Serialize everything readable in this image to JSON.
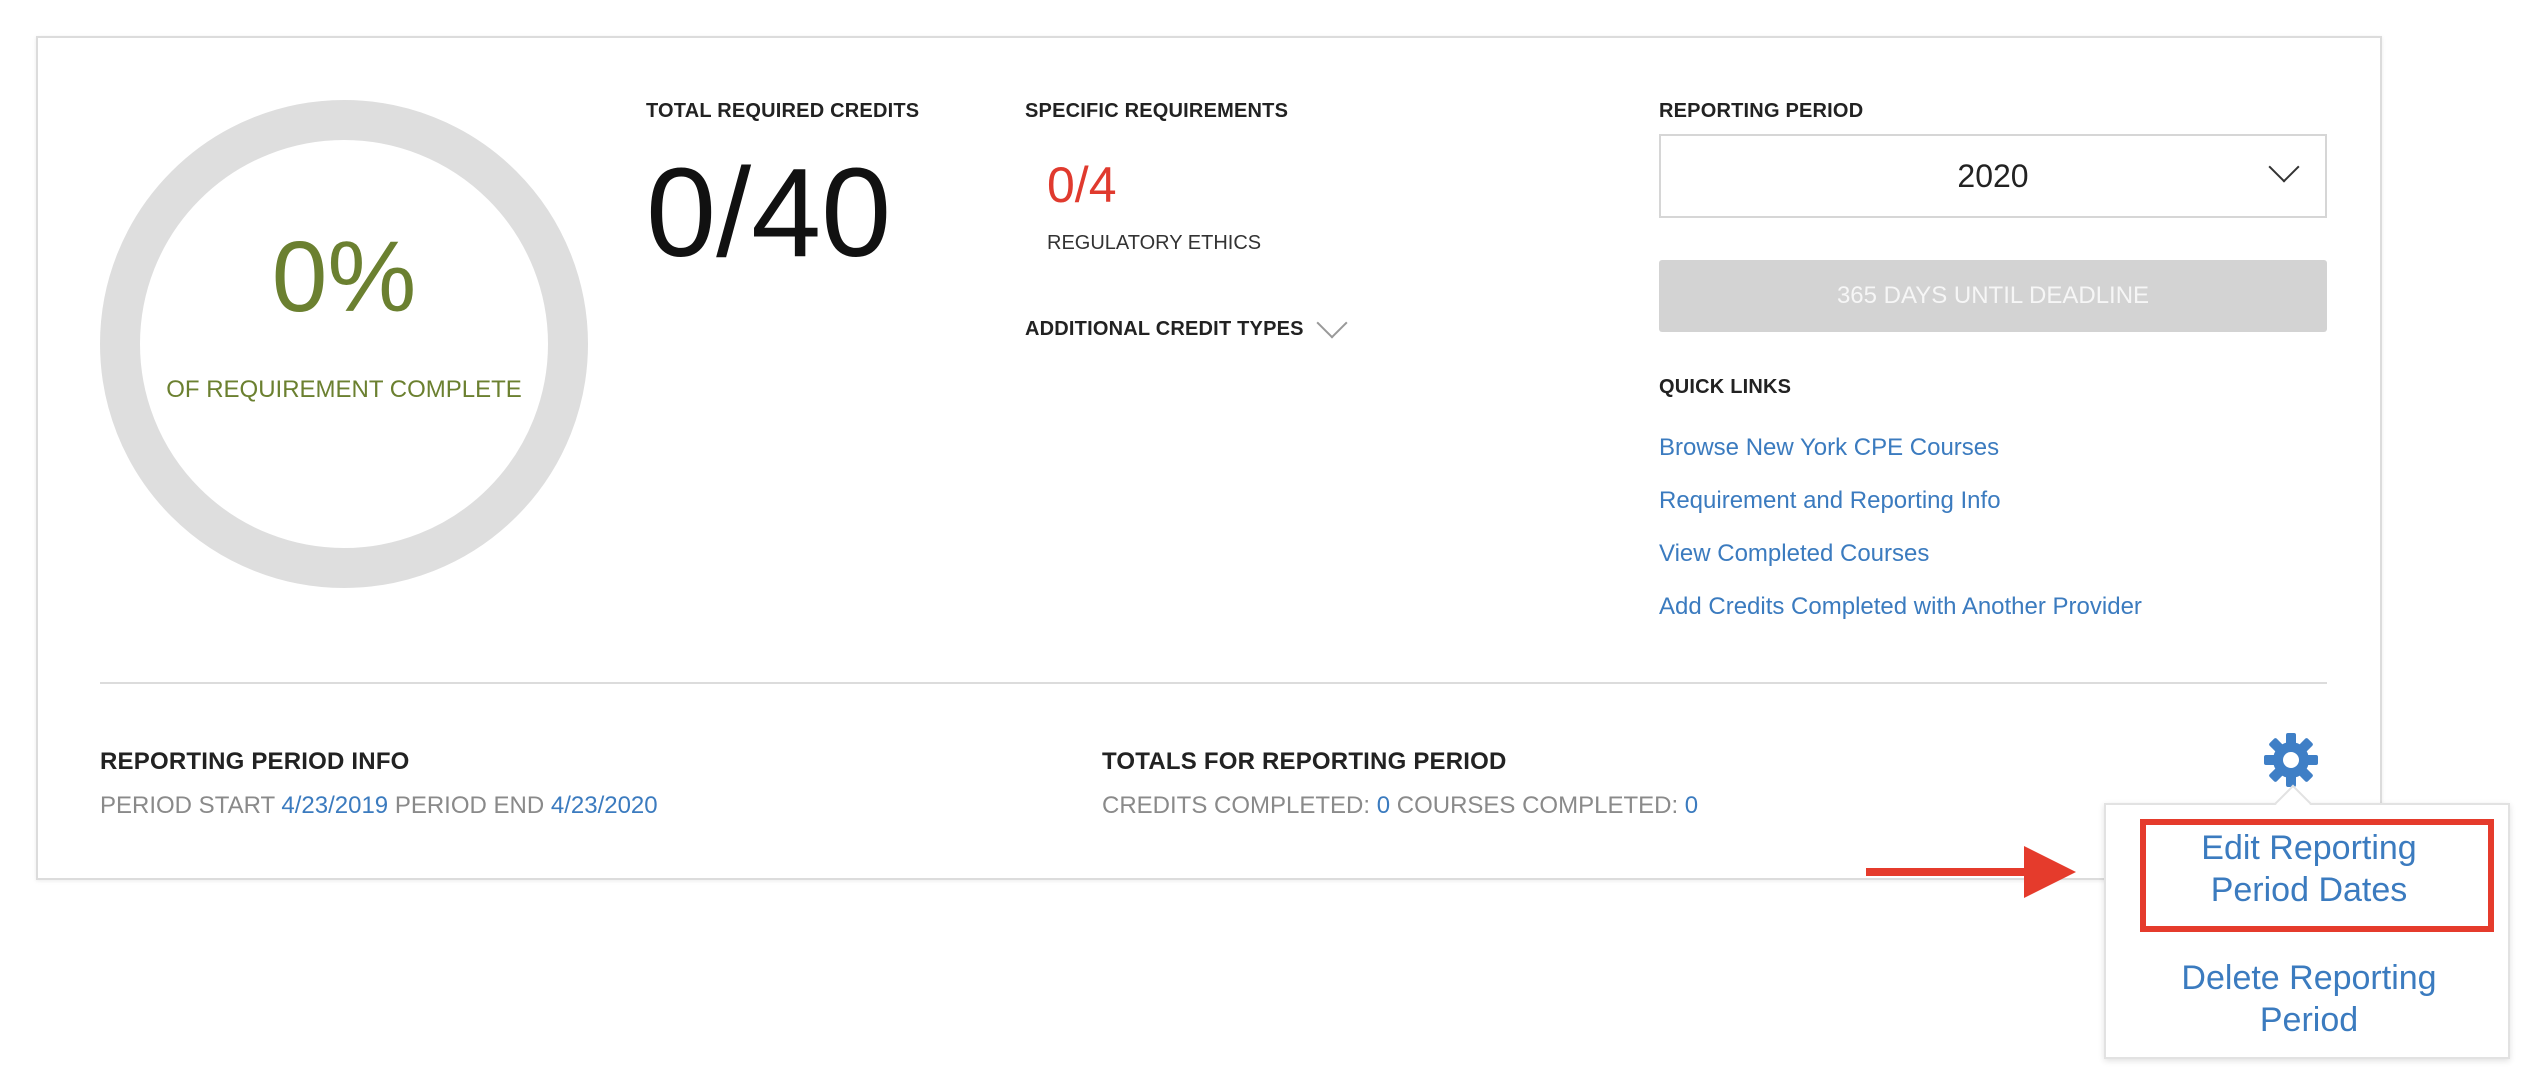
{
  "progress": {
    "percent_text": "0%",
    "label": "OF REQUIREMENT COMPLETE",
    "fraction": 0
  },
  "total_required": {
    "heading": "TOTAL REQUIRED CREDITS",
    "value": "0/40"
  },
  "specific_requirements": {
    "heading": "SPECIFIC REQUIREMENTS",
    "items": [
      {
        "value": "0/4",
        "label": "REGULATORY ETHICS"
      }
    ],
    "additional_label": "ADDITIONAL CREDIT TYPES"
  },
  "reporting_period": {
    "heading": "REPORTING PERIOD",
    "selected": "2020",
    "deadline": "365 DAYS UNTIL DEADLINE"
  },
  "quick_links": {
    "heading": "QUICK LINKS",
    "items": [
      "Browse New York CPE Courses",
      "Requirement and Reporting Info",
      "View Completed Courses",
      "Add Credits Completed with Another Provider"
    ]
  },
  "period_info": {
    "heading": "REPORTING PERIOD INFO",
    "start_label": "PERIOD START",
    "start_value": "4/23/2019",
    "end_label": "PERIOD END",
    "end_value": "4/23/2020"
  },
  "totals": {
    "heading": "TOTALS FOR REPORTING PERIOD",
    "credits_label": "CREDITS COMPLETED:",
    "credits_value": "0",
    "courses_label": "COURSES COMPLETED:",
    "courses_value": "0"
  },
  "settings_menu": {
    "icon": "gear-icon",
    "items": [
      {
        "line1": "Edit Reporting",
        "line2": "Period Dates"
      },
      {
        "line1": "Delete Reporting",
        "line2": "Period"
      }
    ]
  },
  "colors": {
    "accent_green": "#6b8030",
    "link_blue": "#3b7bbf",
    "alert_red": "#e03a2e",
    "annotation_red": "#e53b2c"
  }
}
